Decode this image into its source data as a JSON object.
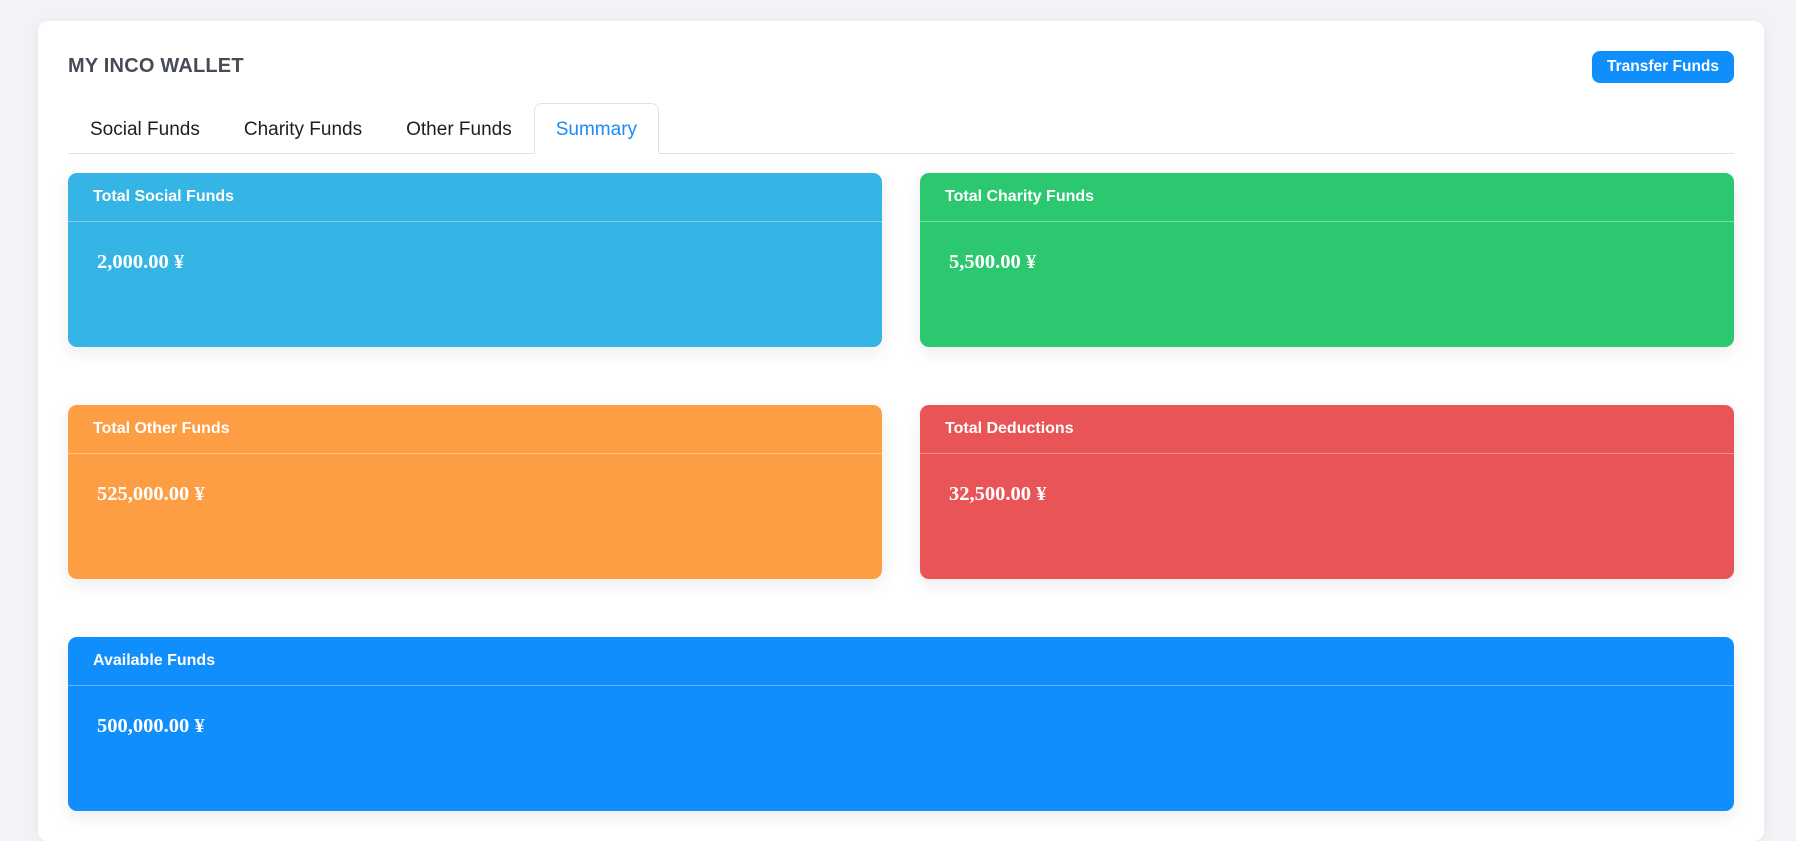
{
  "header": {
    "title": "MY INCO WALLET",
    "transfer_label": "Transfer Funds"
  },
  "tabs": [
    {
      "label": "Social Funds",
      "active": false
    },
    {
      "label": "Charity Funds",
      "active": false
    },
    {
      "label": "Other Funds",
      "active": false
    },
    {
      "label": "Summary",
      "active": true
    }
  ],
  "summary": {
    "social": {
      "label": "Total Social Funds",
      "value": "2,000.00 ¥",
      "color": "#34b5e5"
    },
    "charity": {
      "label": "Total Charity Funds",
      "value": "5,500.00 ¥",
      "color": "#2bc86f"
    },
    "other": {
      "label": "Total Other Funds",
      "value": "525,000.00 ¥",
      "color": "#fe9e44"
    },
    "deductions": {
      "label": "Total Deductions",
      "value": "32,500.00 ¥",
      "color": "#e95557"
    },
    "available": {
      "label": "Available Funds",
      "value": "500,000.00 ¥",
      "color": "#0f8efc"
    }
  },
  "colors": {
    "accent": "#0f8efc",
    "active_tab_text": "#1b8cf5",
    "page_background": "#f2f3f7"
  }
}
